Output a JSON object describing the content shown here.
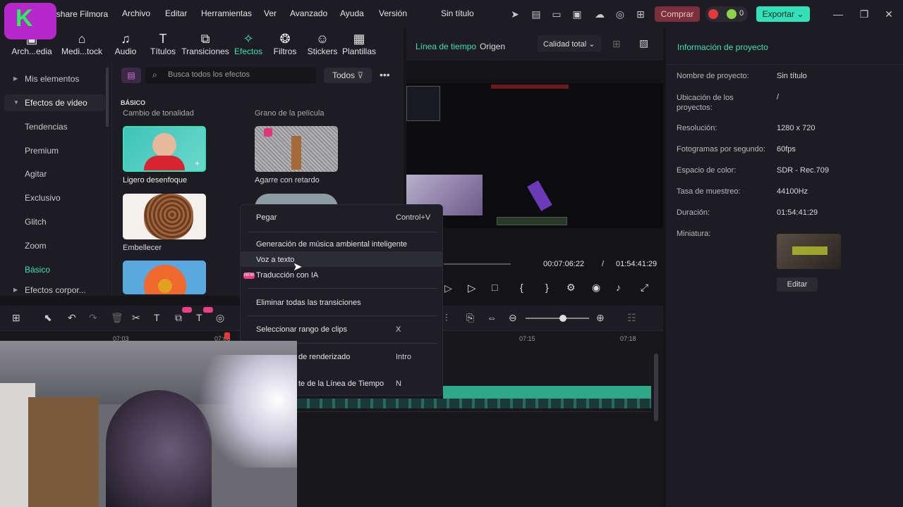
{
  "titlebar": {
    "app_title": "Wondershare Filmora",
    "menu": [
      "Archivo",
      "Editar",
      "Herramientas",
      "Ver",
      "Avanzado",
      "Ayuda",
      "Versión"
    ],
    "project_title": "Sin título",
    "comprar_label": "Comprar",
    "badge_count": "0",
    "exportar_label": "Exportar"
  },
  "toolbar": {
    "tools": [
      "Arch...edia",
      "Medi...tock",
      "Audio",
      "Títulos",
      "Transiciones",
      "Efectos",
      "Filtros",
      "Stickers",
      "Plantillas"
    ]
  },
  "sidebar": {
    "items": [
      "Mis elementos",
      "Efectos de video",
      "Tendencias",
      "Premium",
      "Agitar",
      "Exclusivo",
      "Glitch",
      "Zoom",
      "Básico",
      "Efectos corpor..."
    ]
  },
  "effects": {
    "search_placeholder": "Busca todos los efectos",
    "filter_label": "Todos",
    "section": "BÁSICO",
    "top_captions": [
      "Cambio de tonalidad",
      "Grano de la película"
    ],
    "items": [
      "Ligero desenfoque",
      "Agarre con retardo",
      "Embellecer"
    ]
  },
  "preview": {
    "tab_timeline": "Línea de tiempo",
    "tab_origin": "Origen",
    "quality": "Calidad total",
    "current_time": "00:07:06:22",
    "separator": "/",
    "total_time": "01:54:41:29"
  },
  "info": {
    "title": "Información de proyecto",
    "rows": [
      {
        "label": "Nombre de proyecto:",
        "value": "Sin título"
      },
      {
        "label": "Ubicación de los proyectos:",
        "value": "/"
      },
      {
        "label": "Resolución:",
        "value": "1280 x 720"
      },
      {
        "label": "Fotogramas por segundo:",
        "value": "60fps"
      },
      {
        "label": "Espacio de color:",
        "value": "SDR - Rec.709"
      },
      {
        "label": "Tasa de muestreo:",
        "value": "44100Hz"
      },
      {
        "label": "Duración:",
        "value": "01:54:41:29"
      },
      {
        "label": "Miniatura:",
        "value": ""
      }
    ],
    "edit_label": "Editar"
  },
  "timeline": {
    "ruler": [
      "07:03",
      "07:06",
      "07:15",
      "07:18"
    ]
  },
  "context_menu": {
    "items": [
      {
        "label": "Pegar",
        "key": "Control+V"
      },
      {
        "label": "Generación de música ambiental inteligente",
        "key": ""
      },
      {
        "label": "Voz a texto",
        "key": ""
      },
      {
        "label": "Traducción con IA",
        "key": ""
      },
      {
        "label": "Eliminar todas las transiciones",
        "key": ""
      },
      {
        "label": "Seleccionar rango de clips",
        "key": "X"
      },
      {
        "label": "de renderizado",
        "key": "Intro"
      },
      {
        "label": "te de la Línea de Tiempo",
        "key": "N"
      }
    ],
    "new_badge": "NEW"
  },
  "colors": {
    "accent": "#3de0b4",
    "comprar": "#7a2f3a",
    "exportar": "#34e0b8"
  }
}
